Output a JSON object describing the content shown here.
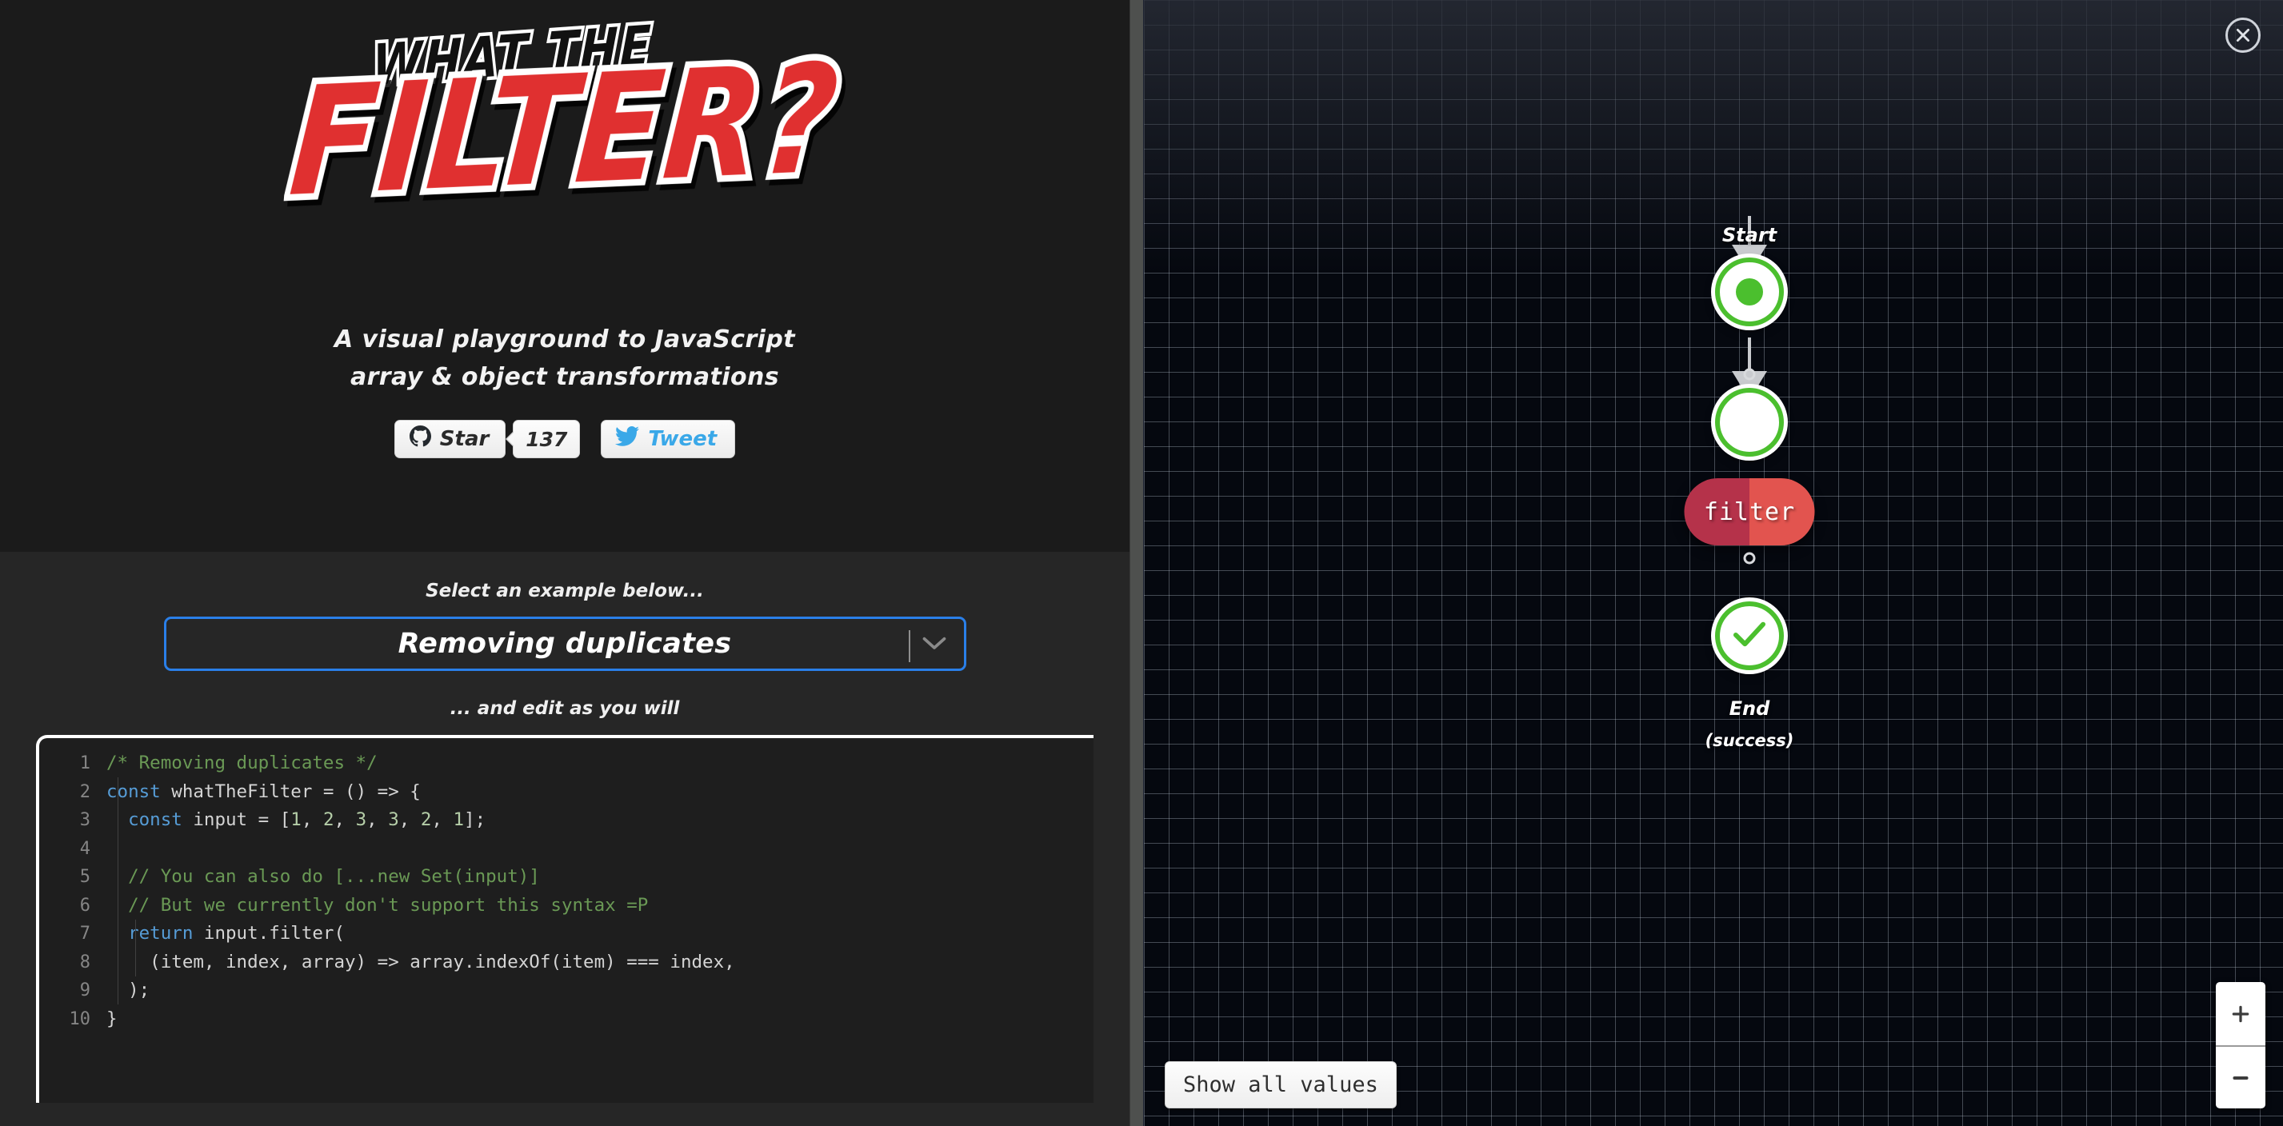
{
  "brand": {
    "logo_line1": "WHAT THE",
    "logo_line2": "FILTER?",
    "tagline_line1": "A visual playground to JavaScript",
    "tagline_line2": "array & object transformations"
  },
  "social": {
    "github_icon": "github-icon",
    "star_label": "Star",
    "star_count": "137",
    "twitter_icon": "twitter-icon",
    "tweet_label": "Tweet"
  },
  "example_picker": {
    "label": "Select an example below...",
    "selected": "Removing duplicates",
    "chevron_icon": "chevron-down-icon",
    "edit_hint": "... and edit as you will"
  },
  "editor": {
    "line_numbers": [
      "1",
      "2",
      "3",
      "4",
      "5",
      "6",
      "7",
      "8",
      "9",
      "10"
    ],
    "lines": [
      [
        {
          "t": "/* Removing duplicates */",
          "c": "tok-comment"
        }
      ],
      [
        {
          "t": "const ",
          "c": "tok-kw"
        },
        {
          "t": "whatTheFilter = () => {",
          "c": "tok-plain"
        }
      ],
      [
        {
          "t": "  ",
          "c": "tok-plain"
        },
        {
          "t": "const ",
          "c": "tok-kw"
        },
        {
          "t": "input = [",
          "c": "tok-plain"
        },
        {
          "t": "1",
          "c": "tok-num"
        },
        {
          "t": ", ",
          "c": "tok-plain"
        },
        {
          "t": "2",
          "c": "tok-num"
        },
        {
          "t": ", ",
          "c": "tok-plain"
        },
        {
          "t": "3",
          "c": "tok-num"
        },
        {
          "t": ", ",
          "c": "tok-plain"
        },
        {
          "t": "3",
          "c": "tok-num"
        },
        {
          "t": ", ",
          "c": "tok-plain"
        },
        {
          "t": "2",
          "c": "tok-num"
        },
        {
          "t": ", ",
          "c": "tok-plain"
        },
        {
          "t": "1",
          "c": "tok-num"
        },
        {
          "t": "];",
          "c": "tok-plain"
        }
      ],
      [
        {
          "t": "",
          "c": "tok-plain"
        }
      ],
      [
        {
          "t": "  // You can also do [...new Set(input)]",
          "c": "tok-comment"
        }
      ],
      [
        {
          "t": "  // But we currently don't support this syntax =P",
          "c": "tok-comment"
        }
      ],
      [
        {
          "t": "  ",
          "c": "tok-plain"
        },
        {
          "t": "return ",
          "c": "tok-kw"
        },
        {
          "t": "input.filter(",
          "c": "tok-plain"
        }
      ],
      [
        {
          "t": "    (item, index, array) => array.indexOf(item) === index,",
          "c": "tok-plain"
        }
      ],
      [
        {
          "t": "  );",
          "c": "tok-plain"
        }
      ],
      [
        {
          "t": "}",
          "c": "tok-plain"
        }
      ]
    ]
  },
  "flow": {
    "close_icon": "close-icon",
    "start_label": "Start",
    "start_icon": "start-circle-icon",
    "filter_node_label": "filter",
    "steps_icon": "footsteps-icon",
    "end_label": "End",
    "end_sublabel": "(success)",
    "end_icon": "check-icon",
    "show_values_label": "Show all values",
    "zoom_in_icon": "plus-icon",
    "zoom_out_icon": "minus-icon"
  },
  "colors": {
    "accent_red": "#e03030",
    "node_green": "#4bbf2e",
    "node_red_dark": "#b5324a",
    "node_red_light": "#e2544f",
    "select_border_blue": "#2a7fe8",
    "twitter_blue": "#3aa8e8",
    "steps_magenta": "#e0219b",
    "canvas_bg": "#05080f"
  }
}
